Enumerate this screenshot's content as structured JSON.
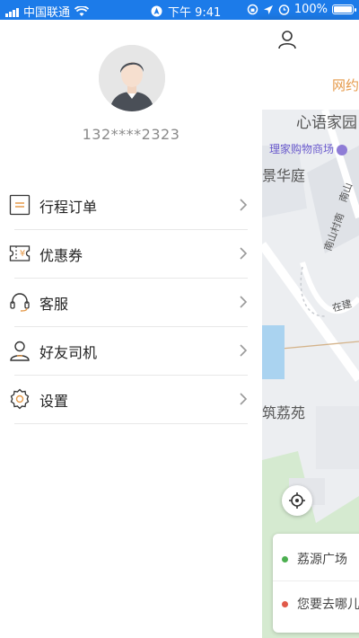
{
  "status_bar": {
    "carrier": "中国联通",
    "time": "下午 9:41",
    "battery": "100%"
  },
  "drawer": {
    "phone": "132****2323",
    "menu": [
      {
        "label": "行程订单",
        "icon": "order-list-icon"
      },
      {
        "label": "优惠券",
        "icon": "coupon-icon"
      },
      {
        "label": "客服",
        "icon": "headset-icon"
      },
      {
        "label": "好友司机",
        "icon": "driver-icon"
      },
      {
        "label": "设置",
        "icon": "gear-icon"
      }
    ]
  },
  "map": {
    "tab_label": "网约",
    "labels": {
      "place1": "心语家园",
      "poi": "理家购物商场",
      "place2": "景华庭",
      "road1": "南山",
      "road2": "南山村南",
      "road3": "在建",
      "place3": "筑荔苑"
    },
    "trip": {
      "from": "荔源广场",
      "to": "您要去哪儿"
    }
  },
  "colors": {
    "status_bar": "#1c7be9",
    "accent": "#e59a4a",
    "start_dot": "#4caf50",
    "end_dot": "#e05a4a"
  }
}
